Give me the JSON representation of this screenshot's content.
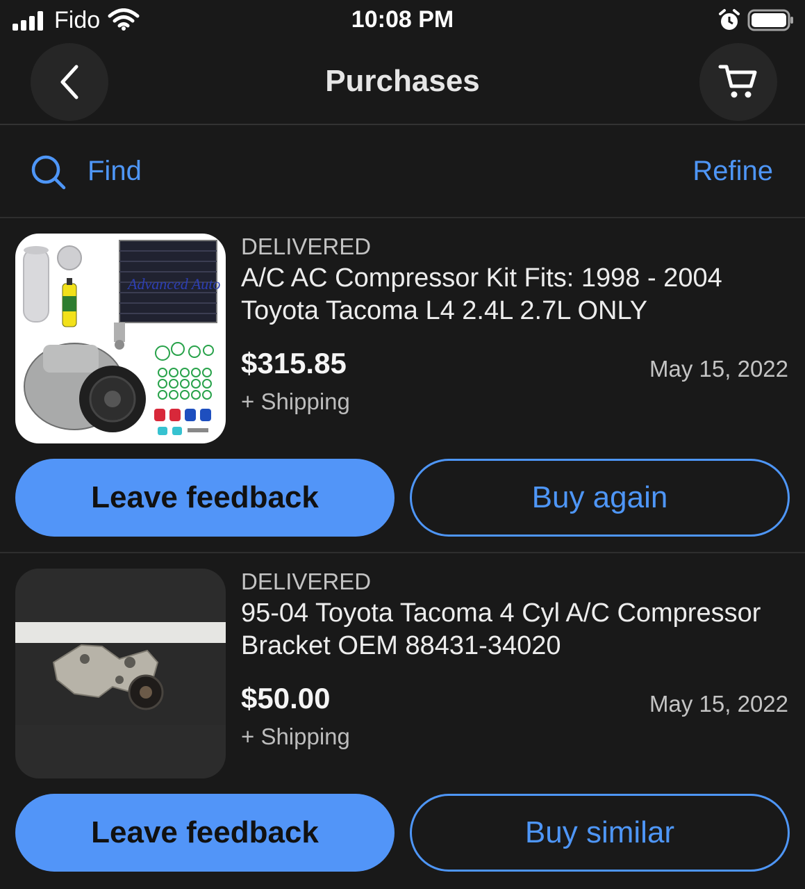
{
  "status_bar": {
    "carrier": "Fido",
    "time": "10:08 PM",
    "icons": [
      "signal-icon",
      "wifi-icon",
      "alarm-icon",
      "battery-icon"
    ]
  },
  "nav": {
    "title": "Purchases",
    "back_icon": "chevron-left-icon",
    "cart_icon": "cart-icon"
  },
  "find_bar": {
    "find_label": "Find",
    "refine_label": "Refine",
    "search_icon": "search-icon"
  },
  "orders": [
    {
      "status": "DELIVERED",
      "title": "A/C AC Compressor Kit Fits: 1998 - 2004 Toyota Tacoma L4 2.4L 2.7L ONLY",
      "price": "$315.85",
      "shipping": "+ Shipping",
      "date": "May 15, 2022",
      "primary_action": "Leave feedback",
      "secondary_action": "Buy again",
      "image_logo_text": "Advanced Auto"
    },
    {
      "status": "DELIVERED",
      "title": "95-04 Toyota Tacoma 4 Cyl A/C Compressor Bracket OEM 88431-34020",
      "price": "$50.00",
      "shipping": "+ Shipping",
      "date": "May 15, 2022",
      "primary_action": "Leave feedback",
      "secondary_action": "Buy similar"
    }
  ],
  "colors": {
    "background": "#191919",
    "accent": "#4e96f7",
    "primary_button": "#5295f8"
  }
}
